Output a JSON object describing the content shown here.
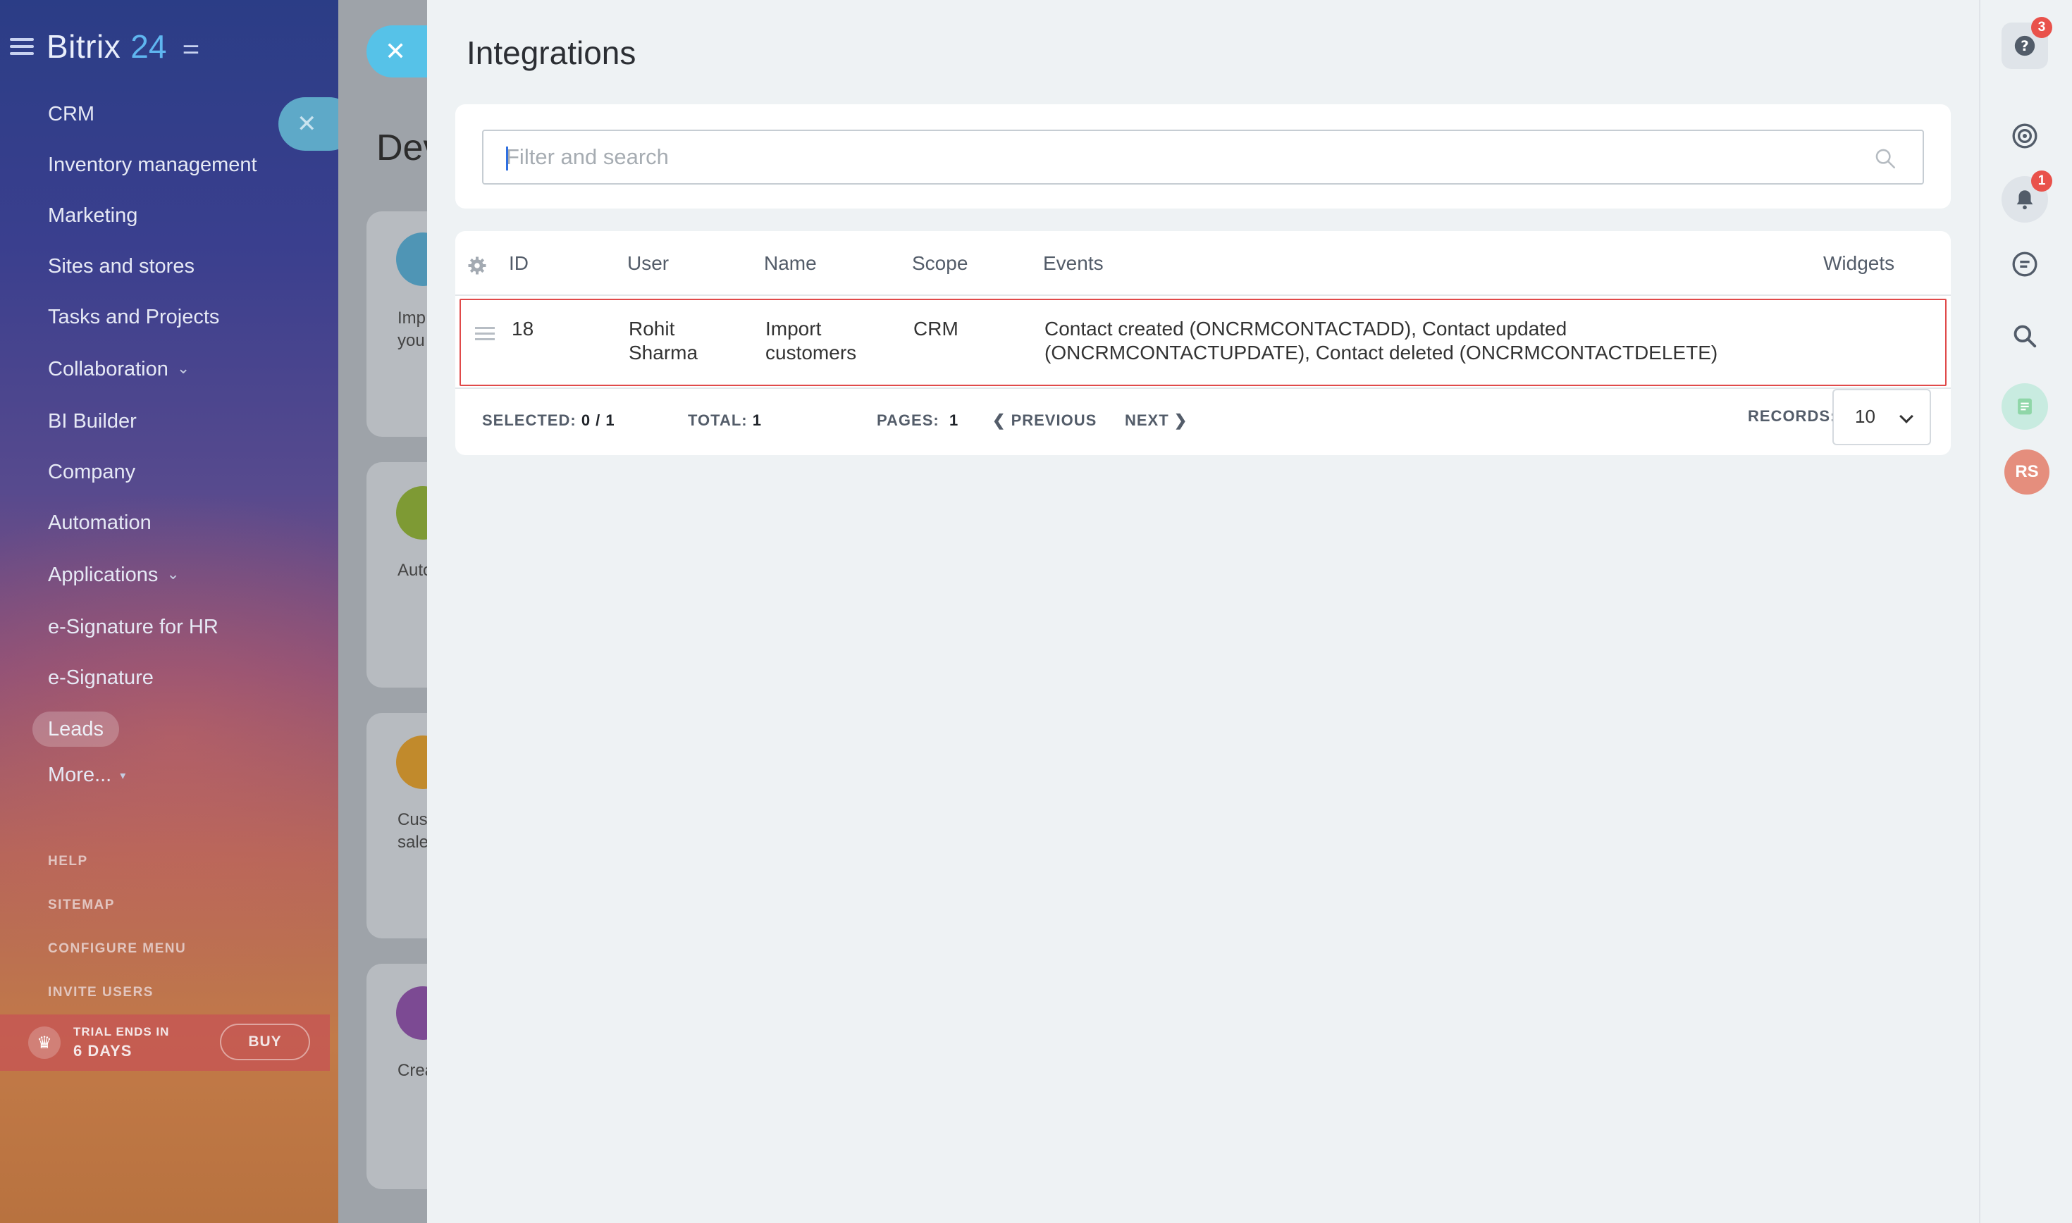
{
  "sidebar": {
    "logo_text": "Bitrix",
    "logo_number": "24",
    "items": [
      {
        "label": "CRM"
      },
      {
        "label": "Inventory management"
      },
      {
        "label": "Marketing"
      },
      {
        "label": "Sites and stores"
      },
      {
        "label": "Tasks and Projects"
      },
      {
        "label": "Collaboration"
      },
      {
        "label": "BI Builder"
      },
      {
        "label": "Company"
      },
      {
        "label": "Automation"
      },
      {
        "label": "Applications"
      },
      {
        "label": "e-Signature for HR"
      },
      {
        "label": "e-Signature"
      },
      {
        "label": "Leads"
      },
      {
        "label": "More..."
      }
    ],
    "utility_links": [
      "HELP",
      "SITEMAP",
      "CONFIGURE MENU",
      "INVITE USERS"
    ],
    "trial": {
      "line1": "TRIAL ENDS IN",
      "line2": "6 DAYS",
      "buy_label": "BUY"
    }
  },
  "background_page": {
    "title_fragment": "Dev",
    "card_texts": [
      [
        "Imp",
        "you"
      ],
      [
        "Auto"
      ],
      [
        "Cus",
        "sale"
      ],
      [
        "Crea"
      ]
    ]
  },
  "panel": {
    "title": "Integrations",
    "search": {
      "placeholder": "Filter and search",
      "value": ""
    },
    "grid": {
      "columns": [
        "ID",
        "User",
        "Name",
        "Scope",
        "Events",
        "Widgets"
      ],
      "rows": [
        {
          "id": "18",
          "user_line1": "Rohit",
          "user_line2": "Sharma",
          "name_line1": "Import",
          "name_line2": "customers",
          "scope": "CRM",
          "events_line1": "Contact created (ONCRMCONTACTADD), Contact updated",
          "events_line2": "(ONCRMCONTACTUPDATE), Contact deleted (ONCRMCONTACTDELETE)",
          "widgets": ""
        }
      ]
    },
    "footer": {
      "selected_label": "SELECTED:",
      "selected_value": "0 / 1",
      "total_label": "TOTAL:",
      "total_value": "1",
      "pages_label": "PAGES:",
      "pages_value": "1",
      "previous_label": "PREVIOUS",
      "next_label": "NEXT",
      "records_label": "RECORDS:",
      "records_value": "10"
    }
  },
  "right_rail": {
    "help_badge": "3",
    "notifications_badge": "1",
    "avatar_initials": "RS"
  },
  "colors": {
    "accent": "#56c2e8",
    "selected_row_border": "#e04a4a",
    "badge": "#e9524b",
    "avatar": "#e58e7d"
  }
}
